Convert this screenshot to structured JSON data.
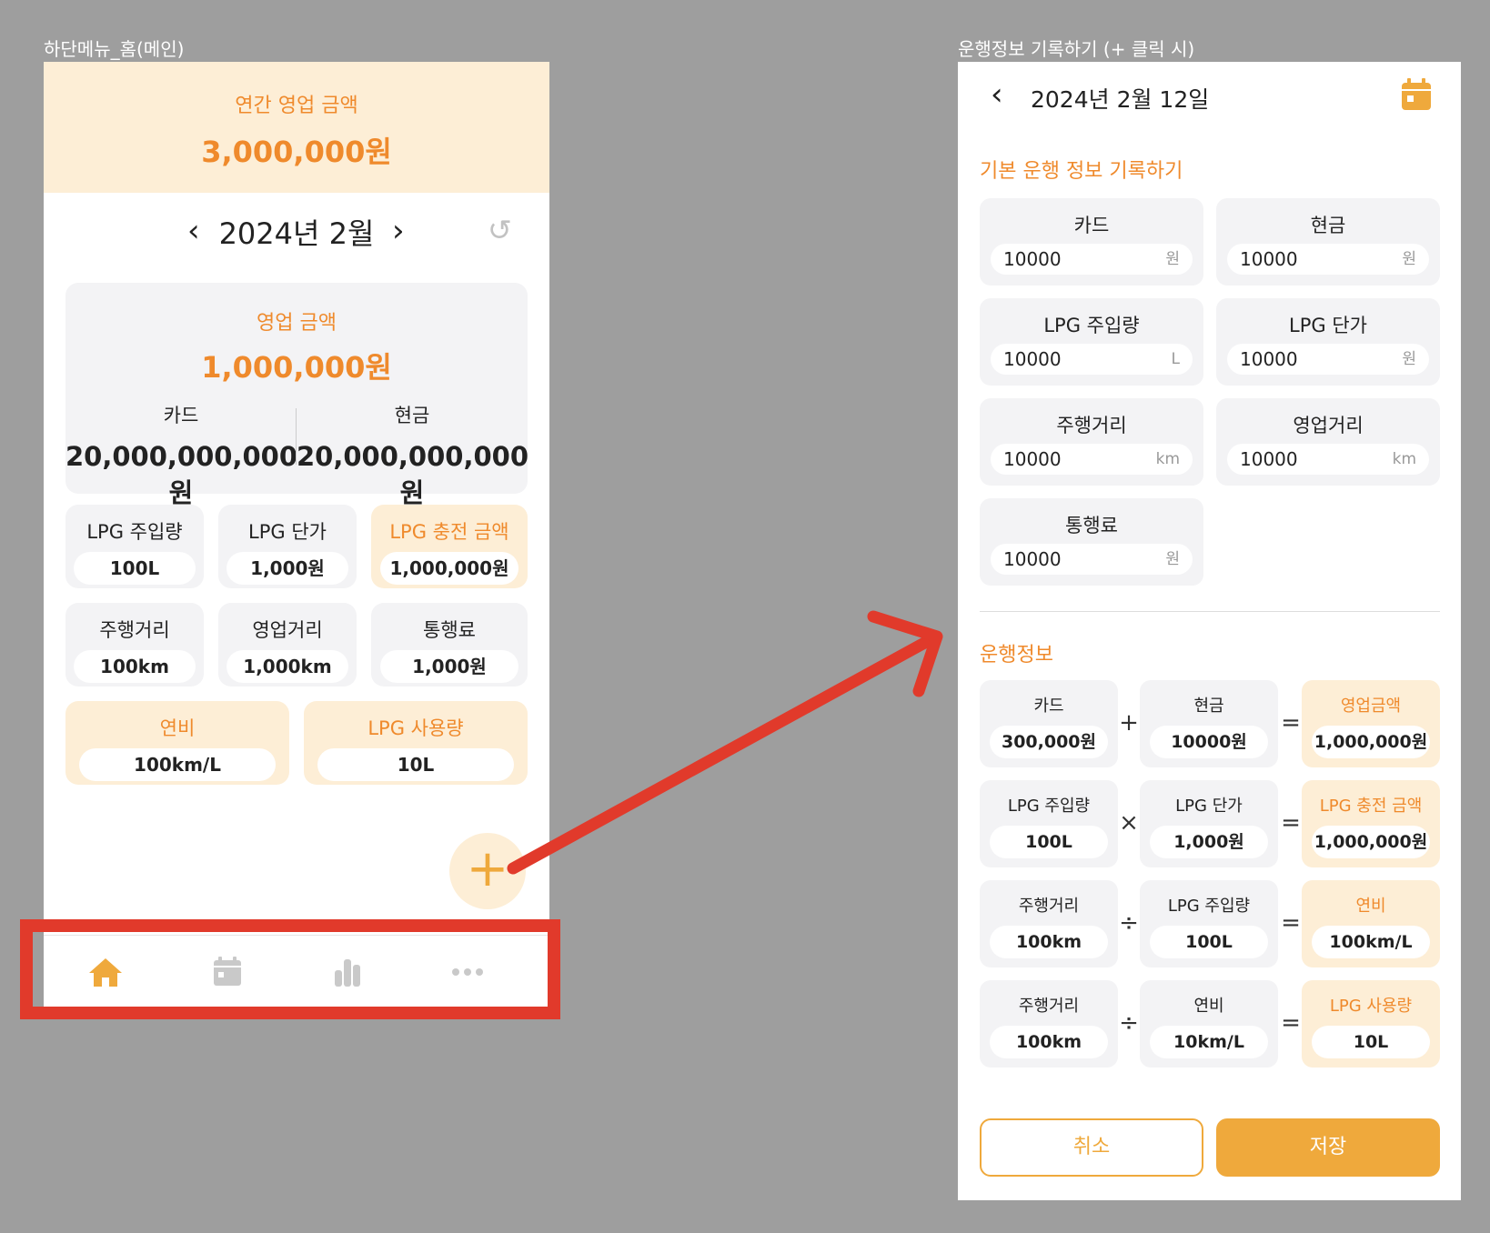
{
  "captions": {
    "left": "하단메뉴_홈(메인)",
    "right": "운행정보 기록하기 (+ 클릭 시)"
  },
  "home": {
    "annual_label": "연간 영업 금액",
    "annual_value": "3,000,000원",
    "month_label": "2024년 2월",
    "sales_label": "영업 금액",
    "sales_value": "1,000,000원",
    "card_label": "카드",
    "card_value": "20,000,000,000원",
    "cash_label": "현금",
    "cash_value": "20,000,000,000원",
    "tiles": [
      {
        "label": "LPG 주입량",
        "value": "100L"
      },
      {
        "label": "LPG 단가",
        "value": "1,000원"
      },
      {
        "label": "LPG 충전 금액",
        "value": "1,000,000원"
      },
      {
        "label": "주행거리",
        "value": "100km"
      },
      {
        "label": "영업거리",
        "value": "1,000km"
      },
      {
        "label": "통행료",
        "value": "1,000원"
      },
      {
        "label": "연비",
        "value": "100km/L"
      },
      {
        "label": "LPG 사용량",
        "value": "10L"
      }
    ],
    "fab_label": "+",
    "nav": [
      "home-icon",
      "calendar-icon",
      "bar-chart-icon",
      "more-icon"
    ]
  },
  "record": {
    "date": "2024년 2월 12일",
    "section_basic": "기본 운행 정보 기록하기",
    "inputs": [
      {
        "label": "카드",
        "value": "10000",
        "unit": "원"
      },
      {
        "label": "현금",
        "value": "10000",
        "unit": "원"
      },
      {
        "label": "LPG 주입량",
        "value": "10000",
        "unit": "L"
      },
      {
        "label": "LPG 단가",
        "value": "10000",
        "unit": "원"
      },
      {
        "label": "주행거리",
        "value": "10000",
        "unit": "km"
      },
      {
        "label": "영업거리",
        "value": "10000",
        "unit": "km"
      },
      {
        "label": "통행료",
        "value": "10000",
        "unit": "원"
      }
    ],
    "section_info": "운행정보",
    "rows": [
      {
        "a": {
          "label": "카드",
          "value": "300,000원"
        },
        "op1": "+",
        "b": {
          "label": "현금",
          "value": "10000원"
        },
        "op2": "=",
        "c": {
          "label": "영업금액",
          "value": "1,000,000원"
        }
      },
      {
        "a": {
          "label": "LPG 주입량",
          "value": "100L"
        },
        "op1": "×",
        "b": {
          "label": "LPG 단가",
          "value": "1,000원"
        },
        "op2": "=",
        "c": {
          "label": "LPG 충전 금액",
          "value": "1,000,000원"
        }
      },
      {
        "a": {
          "label": "주행거리",
          "value": "100km"
        },
        "op1": "÷",
        "b": {
          "label": "LPG 주입량",
          "value": "100L"
        },
        "op2": "=",
        "c": {
          "label": "연비",
          "value": "100km/L"
        }
      },
      {
        "a": {
          "label": "주행거리",
          "value": "100km"
        },
        "op1": "÷",
        "b": {
          "label": "연비",
          "value": "10km/L"
        },
        "op2": "=",
        "c": {
          "label": "LPG 사용량",
          "value": "10L"
        }
      }
    ],
    "cancel_label": "취소",
    "save_label": "저장"
  },
  "colors": {
    "accent": "#efa93c",
    "accent_text": "#ef8a2c",
    "highlight_bg": "#fdeed6",
    "annotation_red": "#e13a2b"
  }
}
